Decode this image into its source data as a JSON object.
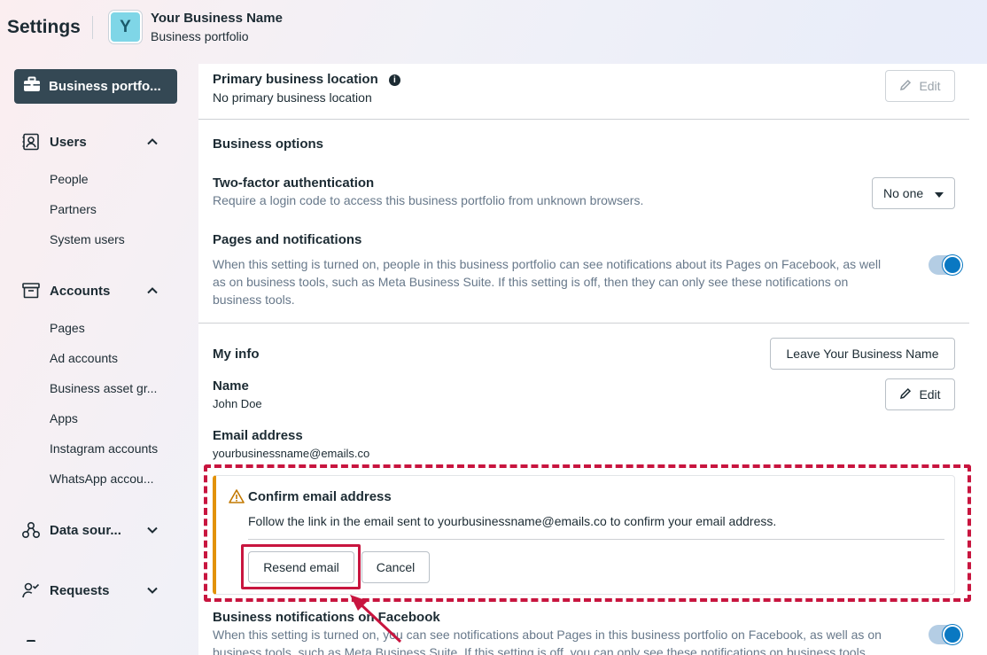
{
  "header": {
    "title": "Settings",
    "business_initial": "Y",
    "business_name": "Your Business Name",
    "business_subtitle": "Business portfolio"
  },
  "sidebar": {
    "active_item": "Business portfo...",
    "sections": [
      {
        "label": "Users",
        "icon": "contact-card-icon",
        "expanded": true,
        "items": [
          "People",
          "Partners",
          "System users"
        ]
      },
      {
        "label": "Accounts",
        "icon": "archive-box-icon",
        "expanded": true,
        "items": [
          "Pages",
          "Ad accounts",
          "Business asset gr...",
          "Apps",
          "Instagram accounts",
          "WhatsApp accou..."
        ]
      },
      {
        "label": "Data sour...",
        "icon": "data-nodes-icon",
        "expanded": false,
        "items": []
      },
      {
        "label": "Requests",
        "icon": "person-check-icon",
        "expanded": false,
        "items": []
      }
    ]
  },
  "main": {
    "primary_location": {
      "title": "Primary business location",
      "value": "No primary business location",
      "edit_label": "Edit"
    },
    "business_options": {
      "heading": "Business options",
      "two_factor": {
        "title": "Two-factor authentication",
        "description": "Require a login code to access this business portfolio from unknown browsers.",
        "selected": "No one"
      },
      "pages_notifications": {
        "title": "Pages and notifications",
        "description_line1": "When this setting is turned on, people in this business portfolio can see notifications about its Pages on Facebook, as well",
        "description_line2": "as on business tools, such as Meta Business Suite. If this setting is off, then they can only see these notifications on",
        "description_line3": "business tools.",
        "enabled": true
      }
    },
    "my_info": {
      "heading": "My info",
      "leave_label": "Leave Your Business Name",
      "name_title": "Name",
      "name_value": "John Doe",
      "name_edit_label": "Edit",
      "email_title": "Email address",
      "email_value": "yourbusinessname@emails.co"
    },
    "confirm_email": {
      "title": "Confirm email address",
      "text": "Follow the link in the email sent to yourbusinessname@emails.co to confirm your email address.",
      "resend_label": "Resend email",
      "cancel_label": "Cancel"
    },
    "business_notifications": {
      "title": "Business notifications on Facebook",
      "description_line1": "When this setting is turned on, you can see notifications about Pages in this business portfolio on Facebook, as well as on",
      "description_line2": "business tools, such as Meta Business Suite. If this setting is off, you can only see these notifications on business tools.",
      "enabled": true
    }
  },
  "colors": {
    "accent": "#0a78c2",
    "highlight": "#c8153f",
    "warning": "#e2920a",
    "sidebar_active": "#344854"
  }
}
